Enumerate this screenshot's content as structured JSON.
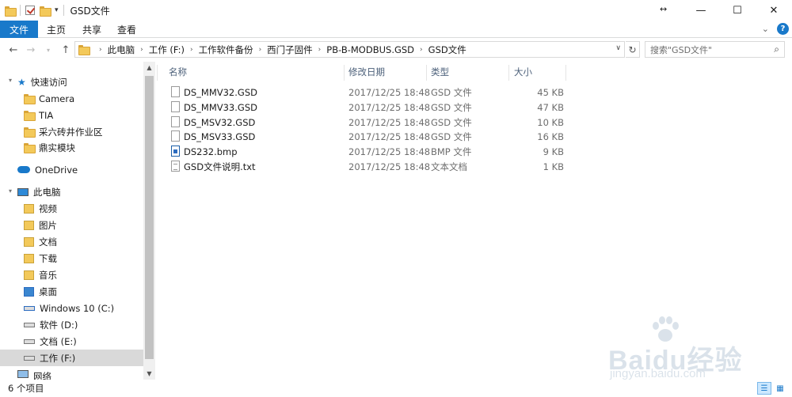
{
  "window": {
    "title": "GSD文件",
    "controls": [
      "minimize",
      "maximize",
      "close"
    ]
  },
  "ribbon": {
    "tabs": [
      {
        "label": "文件"
      },
      {
        "label": "主页"
      },
      {
        "label": "共享"
      },
      {
        "label": "查看"
      }
    ],
    "accent": "#1979ca"
  },
  "address": {
    "crumbs": [
      "此电脑",
      "工作 (F:)",
      "工作软件备份",
      "西门子固件",
      "PB-B-MODBUS.GSD",
      "GSD文件"
    ]
  },
  "search": {
    "placeholder": "搜索\"GSD文件\""
  },
  "nav": {
    "quick_access": "快速访问",
    "quick_items": [
      "Camera",
      "TIA",
      "采六砖井作业区",
      "鼎实模块"
    ],
    "onedrive": "OneDrive",
    "this_pc": "此电脑",
    "pc_items": [
      "视频",
      "图片",
      "文档",
      "下载",
      "音乐",
      "桌面"
    ],
    "drives": [
      "Windows 10 (C:)",
      "软件 (D:)",
      "文档 (E:)",
      "工作 (F:)"
    ],
    "network": "网络"
  },
  "columns": {
    "name": "名称",
    "date": "修改日期",
    "type": "类型",
    "size": "大小"
  },
  "files": [
    {
      "name": "DS_MMV32.GSD",
      "date": "2017/12/25 18:48",
      "type": "GSD 文件",
      "size": "45 KB",
      "icon": "file-icon"
    },
    {
      "name": "DS_MMV33.GSD",
      "date": "2017/12/25 18:48",
      "type": "GSD 文件",
      "size": "47 KB",
      "icon": "file-icon"
    },
    {
      "name": "DS_MSV32.GSD",
      "date": "2017/12/25 18:48",
      "type": "GSD 文件",
      "size": "10 KB",
      "icon": "file-icon"
    },
    {
      "name": "DS_MSV33.GSD",
      "date": "2017/12/25 18:48",
      "type": "GSD 文件",
      "size": "16 KB",
      "icon": "file-icon"
    },
    {
      "name": "DS232.bmp",
      "date": "2017/12/25 18:48",
      "type": "BMP 文件",
      "size": "9 KB",
      "icon": "image-file-icon"
    },
    {
      "name": "GSD文件说明.txt",
      "date": "2017/12/25 18:48",
      "type": "文本文档",
      "size": "1 KB",
      "icon": "text-file-icon"
    }
  ],
  "status": {
    "count": "6 个项目"
  },
  "watermark": {
    "brand": "Baidu经验",
    "url": "jingyan.baidu.com"
  }
}
